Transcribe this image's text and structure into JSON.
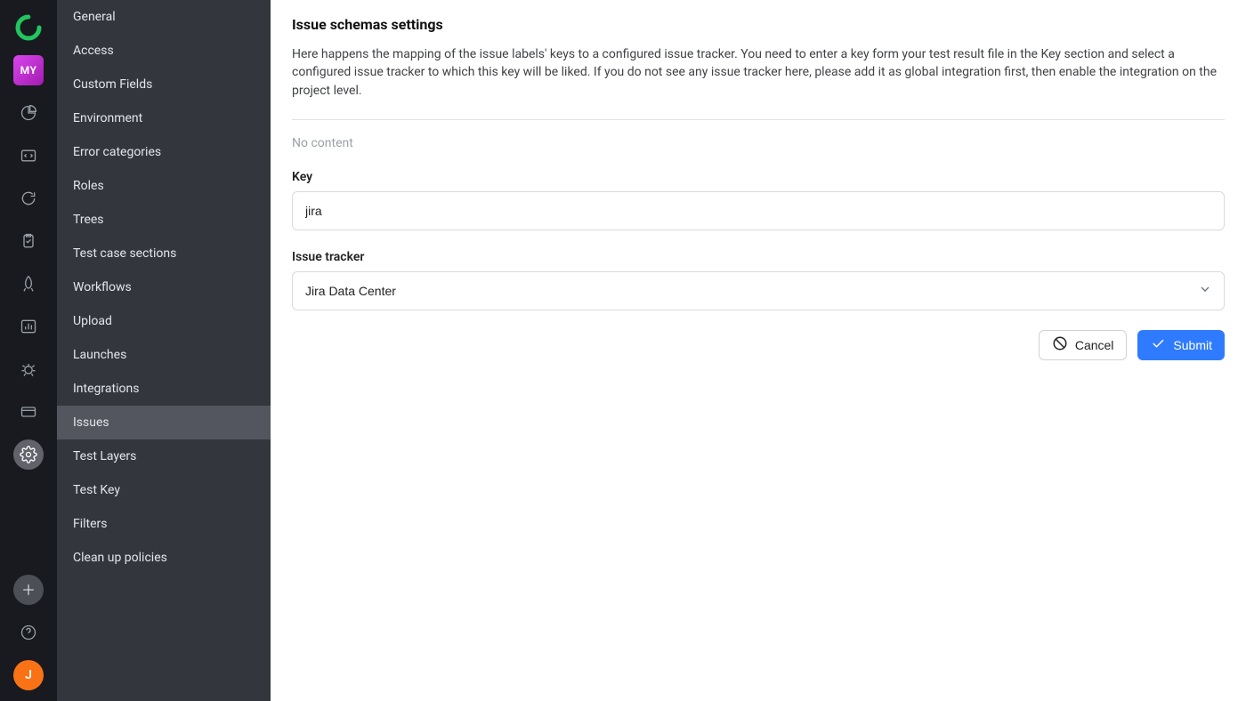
{
  "rail": {
    "project_badge": "MY",
    "user_initial": "J"
  },
  "sidebar": {
    "items": [
      {
        "label": "General",
        "active": false
      },
      {
        "label": "Access",
        "active": false
      },
      {
        "label": "Custom Fields",
        "active": false
      },
      {
        "label": "Environment",
        "active": false
      },
      {
        "label": "Error categories",
        "active": false
      },
      {
        "label": "Roles",
        "active": false
      },
      {
        "label": "Trees",
        "active": false
      },
      {
        "label": "Test case sections",
        "active": false
      },
      {
        "label": "Workflows",
        "active": false
      },
      {
        "label": "Upload",
        "active": false
      },
      {
        "label": "Launches",
        "active": false
      },
      {
        "label": "Integrations",
        "active": false
      },
      {
        "label": "Issues",
        "active": true
      },
      {
        "label": "Test Layers",
        "active": false
      },
      {
        "label": "Test Key",
        "active": false
      },
      {
        "label": "Filters",
        "active": false
      },
      {
        "label": "Clean up policies",
        "active": false
      }
    ]
  },
  "content": {
    "title": "Issue schemas settings",
    "description": "Here happens the mapping of the issue labels' keys to a configured issue tracker. You need to enter a key form your test result file in the Key section and select a configured issue tracker to which this key will be liked. If you do not see any issue tracker here, please add it as global integration first, then enable the integration on the project level.",
    "no_content": "No content",
    "key_label": "Key",
    "key_value": "jira",
    "tracker_label": "Issue tracker",
    "tracker_value": "Jira Data Center",
    "cancel_label": "Cancel",
    "submit_label": "Submit"
  }
}
